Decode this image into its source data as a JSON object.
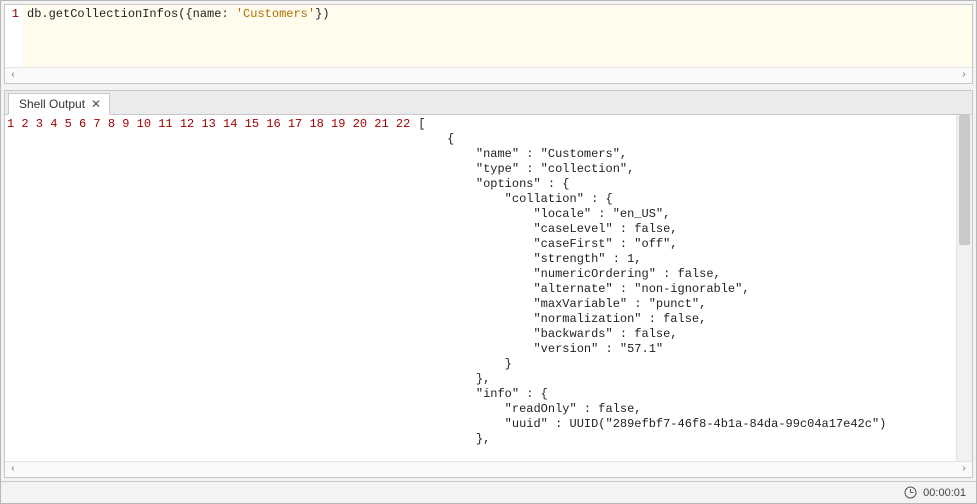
{
  "editor": {
    "lineNumbers": [
      "1"
    ],
    "codeHtml": "db.getCollectionInfos<span class='paren'>(</span><span class='paren'>{</span>name: <span class='str'>'Customers'</span><span class='paren'>}</span><span class='paren'>)</span>"
  },
  "tab": {
    "label": "Shell Output",
    "close": "✕"
  },
  "output": {
    "lines": [
      "[",
      "    {",
      "        \"name\" : \"Customers\",",
      "        \"type\" : \"collection\",",
      "        \"options\" : {",
      "            \"collation\" : {",
      "                \"locale\" : \"en_US\",",
      "                \"caseLevel\" : false,",
      "                \"caseFirst\" : \"off\",",
      "                \"strength\" : 1,",
      "                \"numericOrdering\" : false,",
      "                \"alternate\" : \"non-ignorable\",",
      "                \"maxVariable\" : \"punct\",",
      "                \"normalization\" : false,",
      "                \"backwards\" : false,",
      "                \"version\" : \"57.1\"",
      "            }",
      "        },",
      "        \"info\" : {",
      "            \"readOnly\" : false,",
      "            \"uuid\" : UUID(\"289efbf7-46f8-4b1a-84da-99c04a17e42c\")",
      "        },"
    ]
  },
  "status": {
    "time": "00:00:01"
  },
  "glyphs": {
    "scrollLeft": "‹",
    "scrollRight": "›"
  }
}
